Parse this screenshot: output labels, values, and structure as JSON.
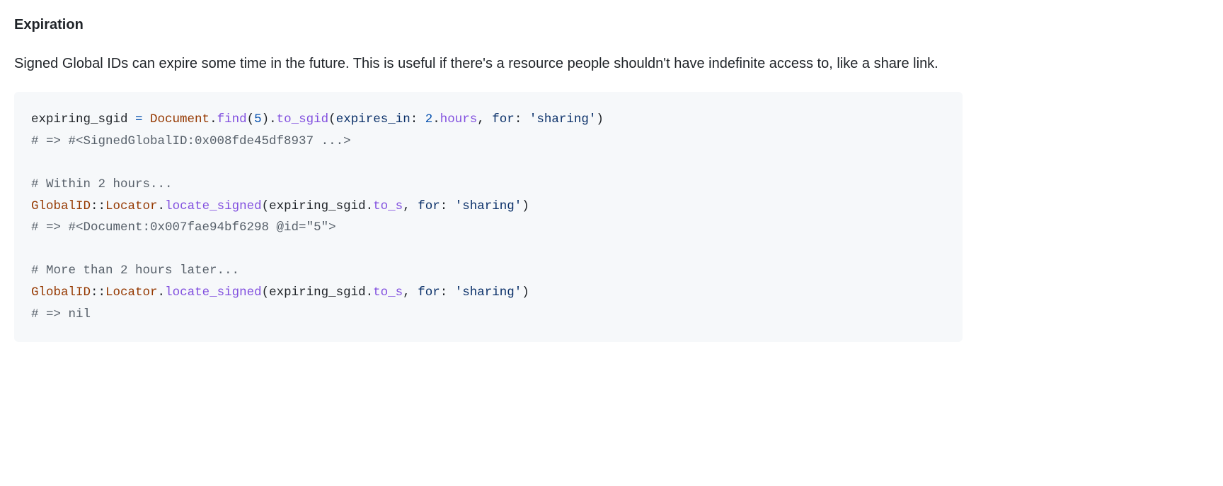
{
  "heading": "Expiration",
  "paragraph": "Signed Global IDs can expire some time in the future. This is useful if there's a resource people shouldn't have indefinite access to, like a share link.",
  "code": {
    "t1": "expiring_sgid",
    "t2": " = ",
    "t3": "Document",
    "t4": ".",
    "t5": "find",
    "t6": "(",
    "t7": "5",
    "t8": ")",
    "t9": ".",
    "t10": "to_sgid",
    "t11": "(",
    "t12": "expires_in",
    "t13": ": ",
    "t14": "2",
    "t15": ".",
    "t16": "hours",
    "t17": ", ",
    "t18": "for",
    "t19": ": ",
    "t20": "'sharing'",
    "t21": ")",
    "t22": "# => #<SignedGlobalID:0x008fde45df8937 ...>",
    "t23": "# Within 2 hours...",
    "t24": "GlobalID",
    "t25": "::",
    "t26": "Locator",
    "t27": ".",
    "t28": "locate_signed",
    "t29": "(",
    "t30": "expiring_sgid",
    "t31": ".",
    "t32": "to_s",
    "t33": ", ",
    "t34": "for",
    "t35": ": ",
    "t36": "'sharing'",
    "t37": ")",
    "t38": "# => #<Document:0x007fae94bf6298 @id=\"5\">",
    "t39": "# More than 2 hours later...",
    "t40": "GlobalID",
    "t41": "::",
    "t42": "Locator",
    "t43": ".",
    "t44": "locate_signed",
    "t45": "(",
    "t46": "expiring_sgid",
    "t47": ".",
    "t48": "to_s",
    "t49": ", ",
    "t50": "for",
    "t51": ": ",
    "t52": "'sharing'",
    "t53": ")",
    "t54": "# => nil"
  }
}
